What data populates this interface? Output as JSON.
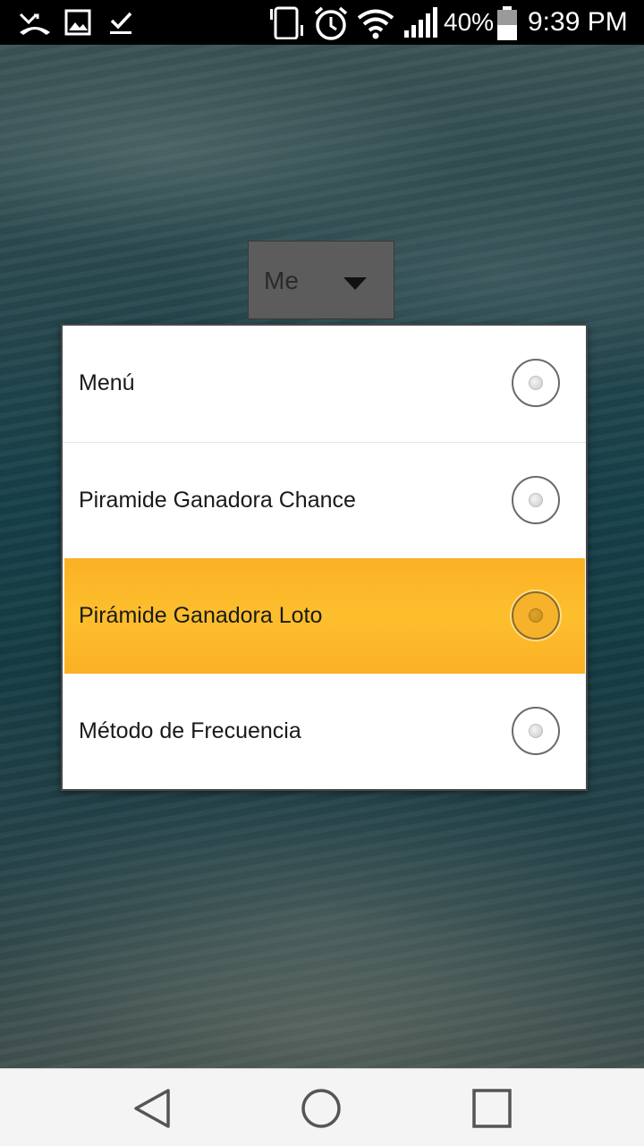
{
  "status_bar": {
    "battery": "40%",
    "time": "9:39 PM",
    "left_icons": [
      "missed-call-icon",
      "image-icon",
      "download-done-icon"
    ],
    "right_icons": [
      "vibrate-icon",
      "alarm-icon",
      "wifi-icon",
      "signal-icon",
      "battery-icon"
    ]
  },
  "spinner": {
    "selected_text": "Me"
  },
  "dialog": {
    "options": [
      {
        "label": "Menú",
        "selected": false
      },
      {
        "label": "Piramide Ganadora Chance",
        "selected": false
      },
      {
        "label": "Pirámide Ganadora Loto",
        "selected": true
      },
      {
        "label": "Método de Frecuencia",
        "selected": false
      }
    ]
  },
  "colors": {
    "highlight": "#fdb92a",
    "dialog_bg": "#ffffff",
    "spinner_bg": "#5c5c5c"
  },
  "nav_bar": {
    "buttons": [
      "back-icon",
      "home-icon",
      "recents-icon"
    ]
  }
}
